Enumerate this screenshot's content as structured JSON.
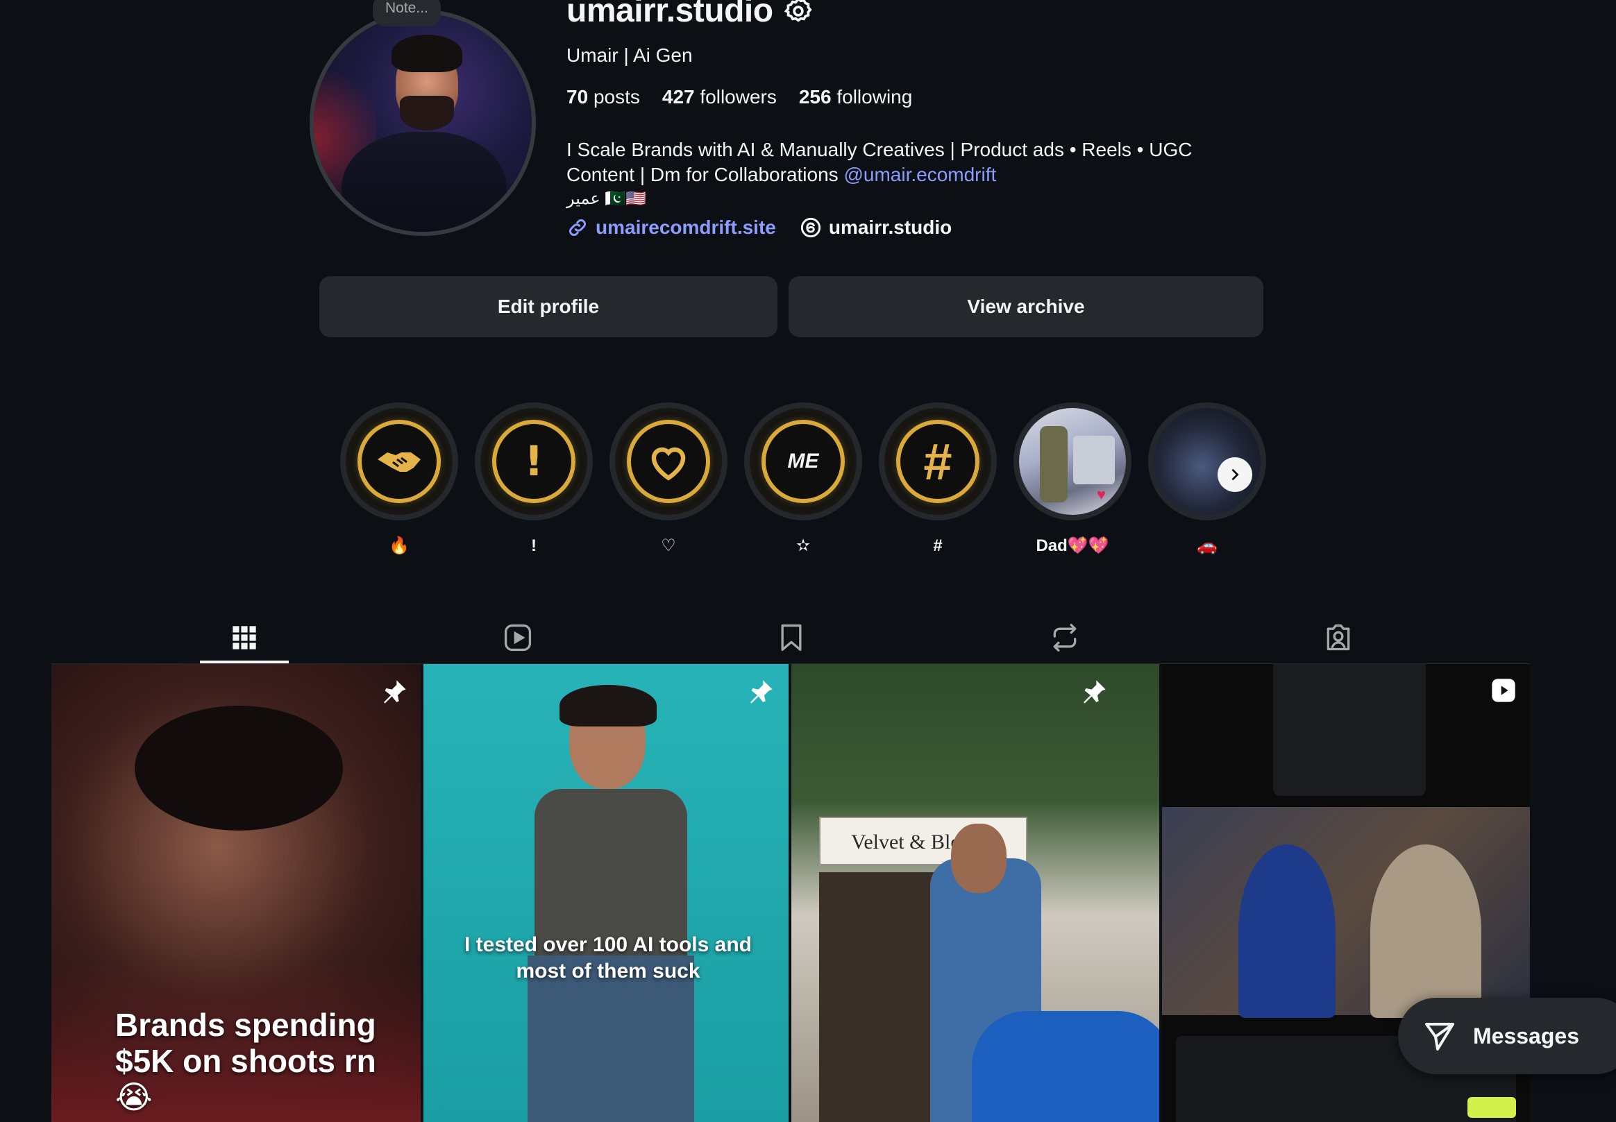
{
  "profile": {
    "note": "Note...",
    "username": "umairr.studio",
    "full_name": "Umair | Ai Gen",
    "stats": {
      "posts_count": "70",
      "posts_label": "posts",
      "followers_count": "427",
      "followers_label": "followers",
      "following_count": "256",
      "following_label": "following"
    },
    "bio_line1": "I Scale Brands with AI & Manually Creatives | Product ads • Reels • UGC",
    "bio_line2": "Content | Dm for Collaborations ",
    "bio_mention": "@umair.ecomdrift",
    "bio_line3": "عمیر 🇵🇰🇺🇸",
    "website": "umairecomdrift.site",
    "threads": "umairr.studio"
  },
  "actions": {
    "edit_profile": "Edit profile",
    "view_archive": "View archive"
  },
  "highlights": [
    {
      "label": "🔥",
      "icon": "handshake-icon"
    },
    {
      "label": "!",
      "icon": "exclamation-icon"
    },
    {
      "label": "♡",
      "icon": "heart-icon"
    },
    {
      "label": "✫",
      "icon": "me-badge"
    },
    {
      "label": "#",
      "icon": "hashtag-icon"
    },
    {
      "label": "Dad💖💖",
      "icon": "photo"
    },
    {
      "label": "🚗",
      "icon": "photo"
    }
  ],
  "highlights_me_text": "ME",
  "tabs": [
    "posts-grid-icon",
    "reels-icon",
    "saved-icon",
    "reposts-icon",
    "tagged-icon"
  ],
  "posts": [
    {
      "caption": "Brands spending $5K on shoots rn😭",
      "pinned": true
    },
    {
      "caption": "I tested over 100 AI tools and most of them suck",
      "pinned": true
    },
    {
      "caption": "",
      "sign_text": "Velvet & Blo",
      "pinned": true
    },
    {
      "caption": "",
      "type": "reel"
    }
  ],
  "messages_label": "Messages"
}
